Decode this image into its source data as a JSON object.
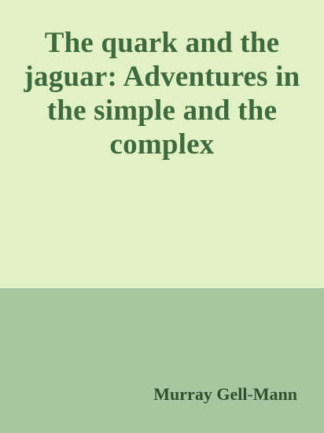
{
  "book": {
    "title": "The quark and the jaguar: Adventures in the simple and the complex",
    "author": "Murray Gell-Mann"
  },
  "colors": {
    "top_background": "#e1f1c3",
    "bottom_background": "#a7c7a0",
    "title_color": "#3f6a3e",
    "author_color": "#2f4f2f"
  }
}
